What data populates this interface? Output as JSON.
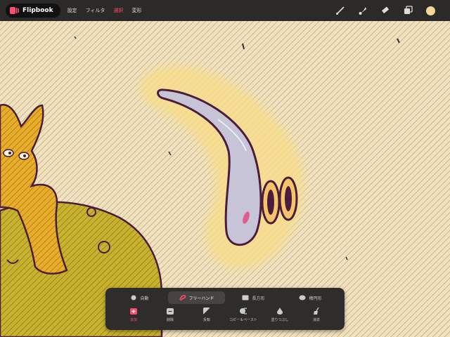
{
  "app": {
    "name": "Flipbook"
  },
  "menu": [
    {
      "label": "設定",
      "active": false
    },
    {
      "label": "フィルタ",
      "active": false
    },
    {
      "label": "選択",
      "active": true
    },
    {
      "label": "変形",
      "active": false
    }
  ],
  "tools": [
    "brush-icon",
    "smudge-icon",
    "eraser-icon",
    "layers-icon",
    "color-swatch"
  ],
  "accent_color": "#ff4d6d",
  "current_color": "#f6d79a",
  "selection_panel": {
    "modes": [
      {
        "label": "自動",
        "icon": "circle-icon"
      },
      {
        "label": "フリーハンド",
        "icon": "lasso-icon",
        "active": true
      },
      {
        "label": "長方形",
        "icon": "rectangle-icon"
      },
      {
        "label": "楕円形",
        "icon": "ellipse-icon"
      }
    ],
    "actions": [
      {
        "label": "追加",
        "icon": "add-icon",
        "active": true
      },
      {
        "label": "削除",
        "icon": "remove-icon"
      },
      {
        "label": "反転",
        "icon": "invert-icon"
      },
      {
        "label": "コピー＆ペースト",
        "icon": "copy-paste-icon"
      },
      {
        "label": "塗りつぶし",
        "icon": "fill-icon"
      },
      {
        "label": "消去",
        "icon": "clear-icon"
      }
    ]
  }
}
